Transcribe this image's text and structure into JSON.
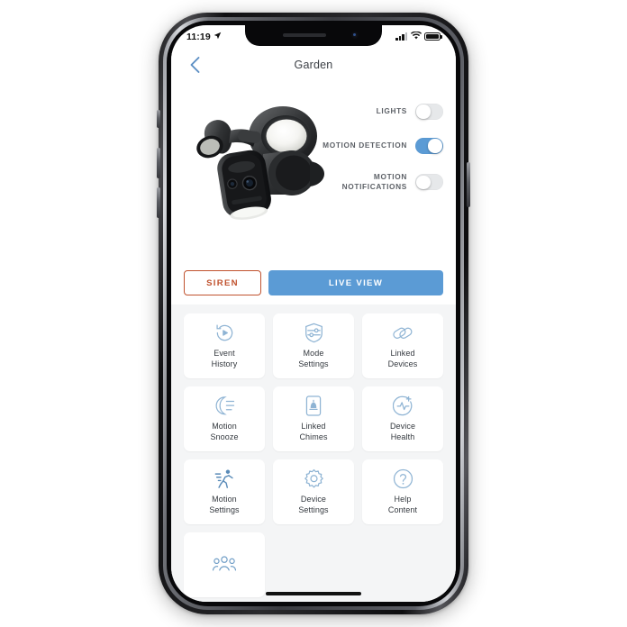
{
  "status_bar": {
    "time": "11:19",
    "location_icon": "location-arrow-icon",
    "signal_icon": "cellular-signal-icon",
    "wifi_icon": "wifi-icon",
    "battery_icon": "battery-icon"
  },
  "nav": {
    "back_icon": "chevron-left-icon",
    "title": "Garden"
  },
  "device": {
    "image_alt": "floodlight-camera"
  },
  "toggles": [
    {
      "label": "LIGHTS",
      "state": "off",
      "name": "lights-toggle"
    },
    {
      "label": "MOTION DETECTION",
      "state": "on",
      "name": "motion-detection-toggle"
    },
    {
      "label": "MOTION NOTIFICATIONS",
      "state": "off",
      "name": "motion-notifications-toggle"
    }
  ],
  "actions": {
    "siren_label": "SIREN",
    "live_view_label": "LIVE VIEW"
  },
  "tiles": [
    {
      "label": "Event\nHistory",
      "icon": "event-history-icon"
    },
    {
      "label": "Mode\nSettings",
      "icon": "mode-settings-icon"
    },
    {
      "label": "Linked\nDevices",
      "icon": "linked-devices-icon"
    },
    {
      "label": "Motion\nSnooze",
      "icon": "motion-snooze-icon"
    },
    {
      "label": "Linked\nChimes",
      "icon": "linked-chimes-icon"
    },
    {
      "label": "Device\nHealth",
      "icon": "device-health-icon"
    },
    {
      "label": "Motion\nSettings",
      "icon": "motion-settings-icon"
    },
    {
      "label": "Device\nSettings",
      "icon": "device-settings-icon"
    },
    {
      "label": "Help\nContent",
      "icon": "help-content-icon"
    }
  ],
  "partial_tile": {
    "icon": "shared-users-icon"
  },
  "colors": {
    "accent_blue": "#5b9bd5",
    "icon_blue": "#8fb4d4",
    "siren_orange": "#c0522e",
    "text_dark": "#33383e",
    "panel_bg": "#f4f5f6"
  }
}
